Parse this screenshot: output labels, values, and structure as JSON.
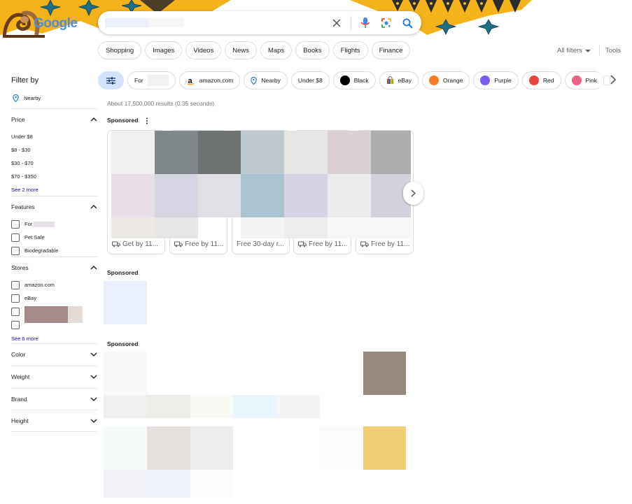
{
  "search": {
    "placeholder": "",
    "clear_icon": "close-icon",
    "voice_icon": "mic-icon",
    "lens_icon": "camera-lens-icon",
    "search_icon": "search-icon"
  },
  "tabs": [
    "Shopping",
    "Images",
    "Videos",
    "News",
    "Maps",
    "Books",
    "Flights",
    "Finance"
  ],
  "toolbar": {
    "all_filters": "All filters",
    "tools": "Tools"
  },
  "sidebar": {
    "title": "Filter by",
    "nearby": "Nearby",
    "price": {
      "heading": "Price",
      "items": [
        "Under $8",
        "$8 - $30",
        "$30 - $70",
        "$70 - $350"
      ],
      "see_more": "See 2 more"
    },
    "features": {
      "heading": "Features",
      "items": [
        "For",
        "Pet Safe",
        "Biodegradable"
      ]
    },
    "stores": {
      "heading": "Stores",
      "items": [
        "amazon.com",
        "eBay",
        "",
        ""
      ],
      "see_more": "See 6 more"
    },
    "collapsed": [
      "Color",
      "Weight",
      "Brand",
      "Height"
    ]
  },
  "chips": [
    {
      "label": "For"
    },
    {
      "label": "amazon.com"
    },
    {
      "label": "Nearby"
    },
    {
      "label": "Under $8"
    },
    {
      "label": "Black",
      "color": "#000000"
    },
    {
      "label": "eBay"
    },
    {
      "label": "Orange",
      "color": "#f97b27"
    },
    {
      "label": "Purple",
      "color": "#7b5cf0"
    },
    {
      "label": "Red",
      "color": "#e8453c"
    },
    {
      "label": "Pink",
      "color": "#f06283"
    }
  ],
  "results": {
    "count": "About 17,500,000 results (0.35 seconds)",
    "sponsored": "Sponsored"
  },
  "products": [
    {
      "shipping": "Get by 11..."
    },
    {
      "shipping": "Free by 11..."
    },
    {
      "shipping": "Free 30-day r..."
    },
    {
      "shipping": "Free by 11..."
    },
    {
      "shipping": "Free by 11..."
    }
  ],
  "colors": {
    "accent": "#1a73e8",
    "link": "#1a0dab",
    "doodle_yellow": "#f4b21b"
  }
}
